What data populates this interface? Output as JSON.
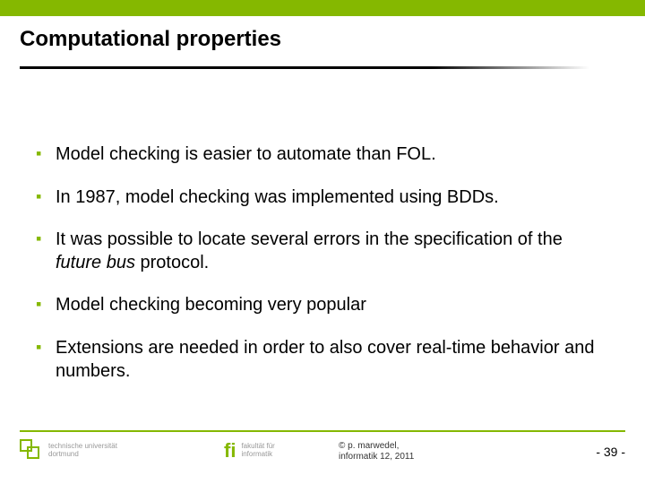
{
  "title": "Computational properties",
  "bullets": [
    {
      "text": "Model checking is easier to automate than FOL."
    },
    {
      "text": "In 1987, model checking was implemented using BDDs."
    },
    {
      "prefix": "It was possible to locate several errors in the specification of the ",
      "ital": "future bus",
      "suffix": " protocol."
    },
    {
      "text": "Model checking becoming very popular"
    },
    {
      "text": "Extensions are needed in order to also cover real-time behavior and numbers."
    }
  ],
  "footer": {
    "tu": {
      "line1": "technische universität",
      "line2": "dortmund"
    },
    "fi": {
      "mark": "fi",
      "line1": "fakultät für",
      "line2": "informatik"
    },
    "copy": {
      "line1": "© p. marwedel,",
      "line2": "informatik 12, 2011"
    },
    "pagenum": "-  39  -"
  }
}
